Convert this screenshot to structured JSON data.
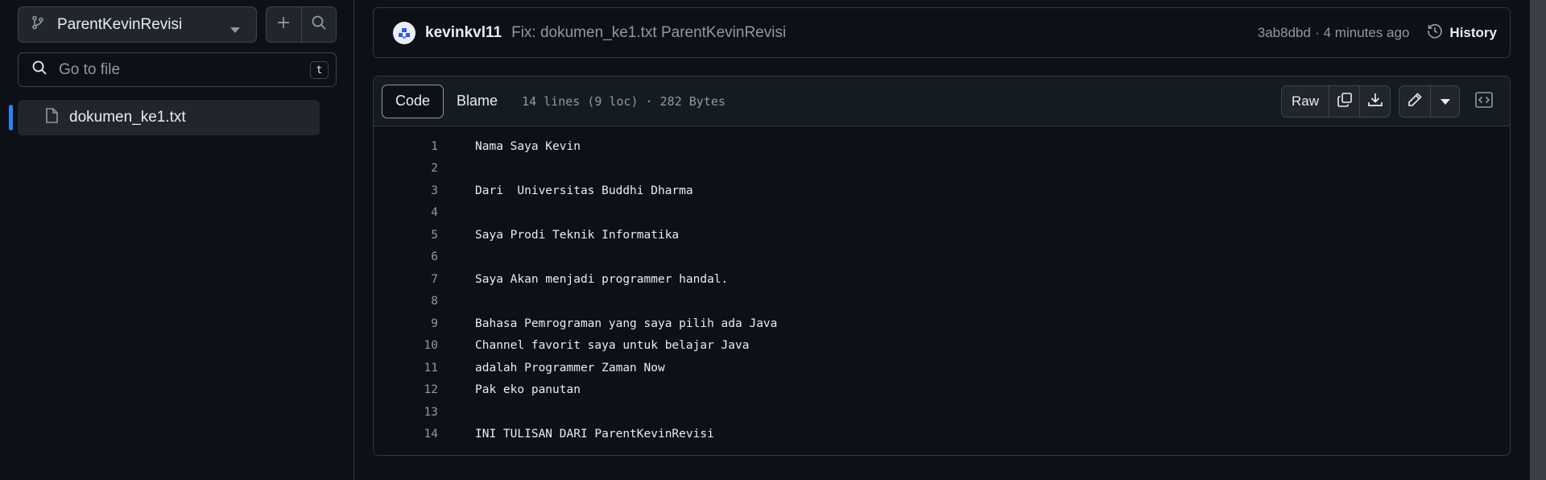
{
  "sidebar": {
    "branch": "ParentKevinRevisi",
    "goto_placeholder": "Go to file",
    "goto_shortcut": "t",
    "files": [
      {
        "name": "dokumen_ke1.txt",
        "active": true
      }
    ]
  },
  "commit": {
    "author": "kevinkvl11",
    "message": "Fix: dokumen_ke1.txt ParentKevinRevisi",
    "hash": "3ab8dbd",
    "separator": "·",
    "time": "4 minutes ago",
    "history_label": "History"
  },
  "file": {
    "tabs": [
      "Code",
      "Blame"
    ],
    "selected_tab": "Code",
    "info": "14 lines (9 loc) · 282 Bytes",
    "raw_label": "Raw",
    "lines": [
      "Nama Saya Kevin",
      "",
      "Dari  Universitas Buddhi Dharma",
      "",
      "Saya Prodi Teknik Informatika",
      "",
      "Saya Akan menjadi programmer handal.",
      "",
      "Bahasa Pemrograman yang saya pilih ada Java",
      "Channel favorit saya untuk belajar Java",
      "adalah Programmer Zaman Now",
      "Pak eko panutan",
      "",
      "INI TULISAN DARI ParentKevinRevisi"
    ]
  },
  "colors": {
    "background": "#0d1117",
    "border": "#30363d",
    "accent": "#2f81f7",
    "muted_text": "#9198a1"
  },
  "icons": {
    "branch": "git-branch-icon",
    "add": "plus-icon",
    "search": "search-icon",
    "file": "file-icon",
    "history": "history-icon",
    "copy": "copy-icon",
    "download": "download-icon",
    "edit": "pencil-icon",
    "dropdown": "triangle-down-icon",
    "symbols": "code-square-icon"
  }
}
